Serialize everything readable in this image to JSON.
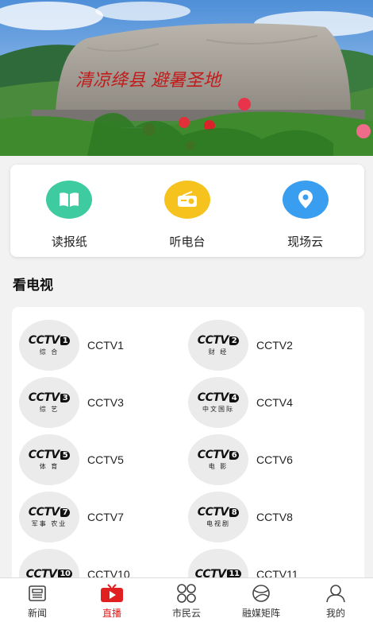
{
  "banner": {
    "stone_inscription": "清凉绛县 避暑圣地"
  },
  "quick_actions": [
    {
      "label": "读报纸",
      "icon": "book-icon",
      "color": "#3ecb9f"
    },
    {
      "label": "听电台",
      "icon": "radio-icon",
      "color": "#f6c21d"
    },
    {
      "label": "现场云",
      "icon": "location-pin-icon",
      "color": "#3a9ef0"
    }
  ],
  "section_title": "看电视",
  "channels": [
    {
      "name": "CCTV1",
      "num": "1",
      "sub": "综 合"
    },
    {
      "name": "CCTV2",
      "num": "2",
      "sub": "财 经"
    },
    {
      "name": "CCTV3",
      "num": "3",
      "sub": "综 艺"
    },
    {
      "name": "CCTV4",
      "num": "4",
      "sub": "中文国际"
    },
    {
      "name": "CCTV5",
      "num": "5",
      "sub": "体 育"
    },
    {
      "name": "CCTV6",
      "num": "6",
      "sub": "电 影"
    },
    {
      "name": "CCTV7",
      "num": "7",
      "sub": "军事 农业"
    },
    {
      "name": "CCTV8",
      "num": "8",
      "sub": "电视剧"
    },
    {
      "name": "CCTV10",
      "num": "10",
      "sub": ""
    },
    {
      "name": "CCTV11",
      "num": "11",
      "sub": ""
    }
  ],
  "channel_logo_text": "CCTV",
  "nav": [
    {
      "label": "新闻",
      "icon": "newspaper-icon",
      "active": false
    },
    {
      "label": "直播",
      "icon": "tv-play-icon",
      "active": true
    },
    {
      "label": "市民云",
      "icon": "grid-circles-icon",
      "active": false
    },
    {
      "label": "融媒矩阵",
      "icon": "globe-icon",
      "active": false
    },
    {
      "label": "我的",
      "icon": "user-icon",
      "active": false
    }
  ],
  "colors": {
    "accent": "#e02020"
  }
}
